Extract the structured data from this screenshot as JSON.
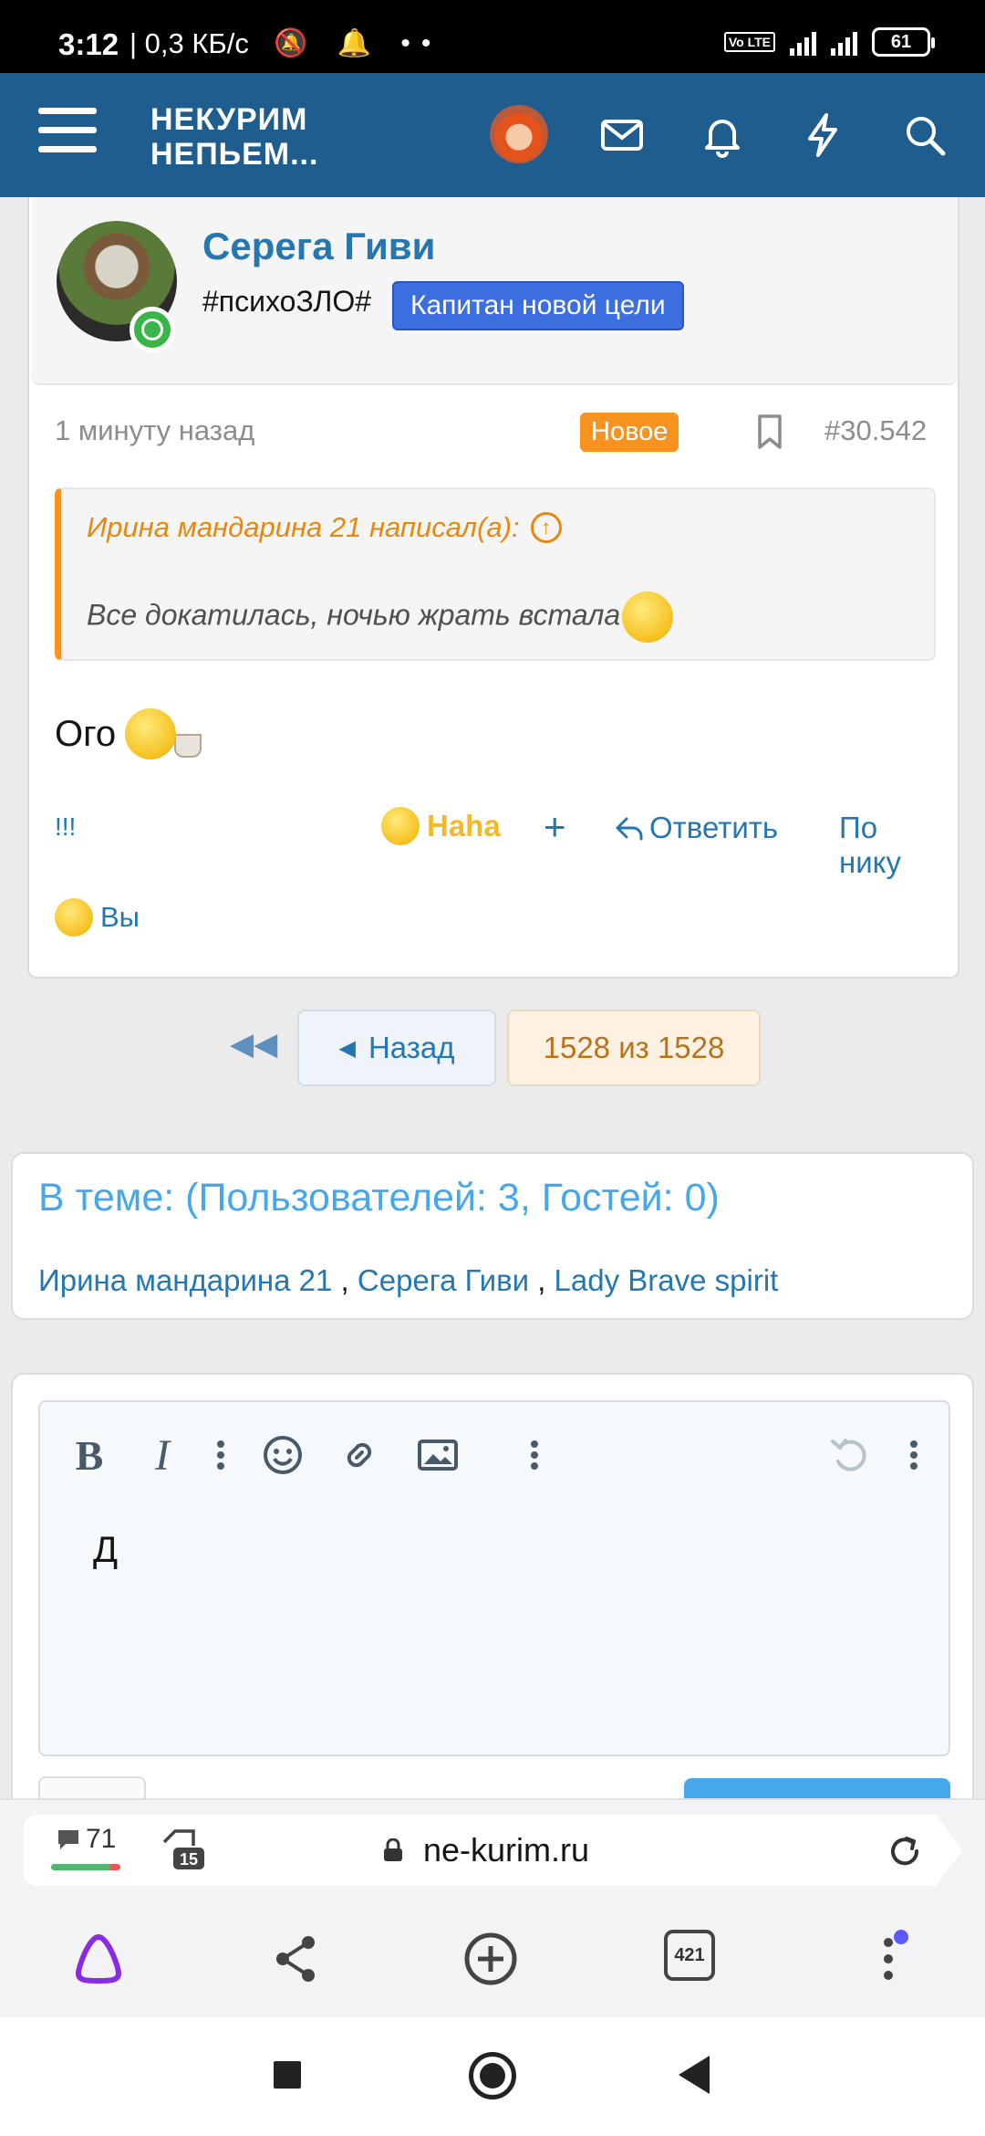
{
  "status_bar": {
    "time": "3:12",
    "network_speed": "| 0,3 КБ/с",
    "indicators": "🔕 🔔 ••",
    "volte": "Vo LTE",
    "network_type": "4G",
    "battery": "61"
  },
  "header": {
    "logo_line1": "НЕКУРИМ",
    "logo_line2": "НЕПЬЕМ...",
    "colors": {
      "bar": "#1f5d8f"
    }
  },
  "post": {
    "username": "Серега Гиви",
    "user_title": "#психоЗЛО#",
    "user_banner": "Капитан новой цели",
    "time": "1 минуту назад",
    "badge_new": "Новое",
    "post_number": "#30.542",
    "quote_author": "Ирина мандарина 21 написал(а):",
    "quote_text": "Все докатилась, ночью жрать встала",
    "body_text": "Ого",
    "actions": {
      "report": "!!!",
      "reaction": "Haha",
      "plus": "+",
      "reply": "Ответить",
      "by_nick": "По нику"
    },
    "reactions_by": "Вы"
  },
  "pagination": {
    "prev_label": "Назад",
    "current": "1528 из 1528"
  },
  "online": {
    "title": "В теме: (Пользователей: 3, Гостей: 0)",
    "users": [
      "Ирина мандарина 21",
      "Серега Гиви",
      "Lady Brave spirit"
    ],
    "separator": " , "
  },
  "editor": {
    "text": "Д"
  },
  "browser": {
    "comments_count": "71",
    "tabs_badge": "15",
    "url": "ne-kurim.ru",
    "tab_count": "421"
  }
}
